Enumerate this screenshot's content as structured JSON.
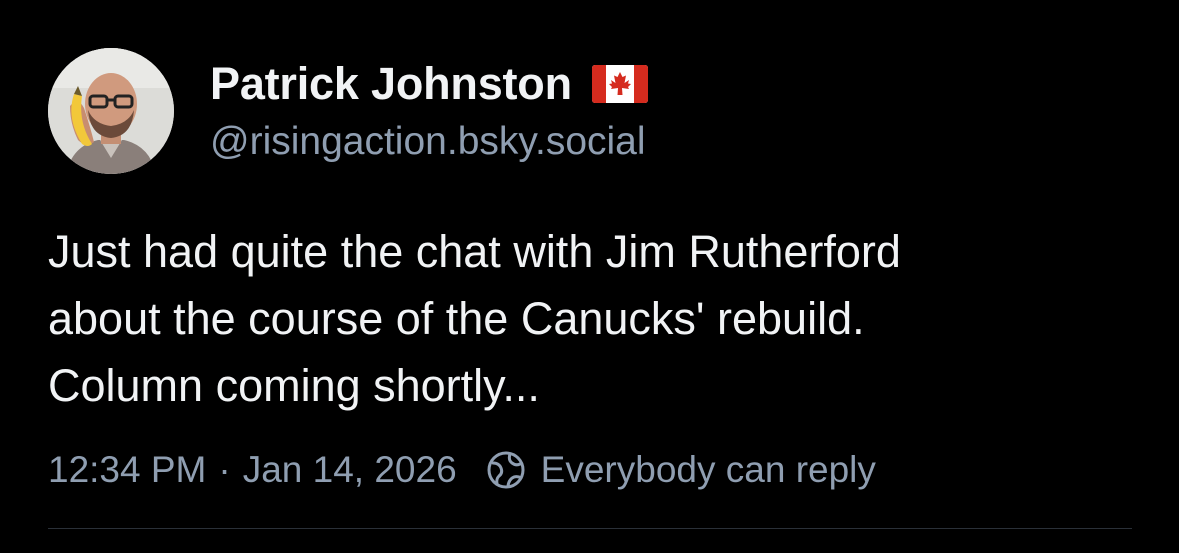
{
  "author": {
    "display_name": "Patrick Johnston",
    "flag_icon": "canada-flag-icon",
    "handle": "@risingaction.bsky.social",
    "avatar_icon": "avatar-photo"
  },
  "post": {
    "text": "Just had quite the chat with Jim Rutherford\nabout the course of the Canucks' rebuild.\nColumn coming shortly..."
  },
  "meta": {
    "time": "12:34 PM",
    "separator": "·",
    "date": "Jan 14, 2026",
    "reply_setting_icon": "globe-icon",
    "reply_setting": "Everybody can reply"
  },
  "colors": {
    "background": "#000000",
    "primary_text": "#f1f3f5",
    "secondary_text": "#8f9eb1",
    "divider": "#2a3038",
    "flag_red": "#d52b1e"
  }
}
